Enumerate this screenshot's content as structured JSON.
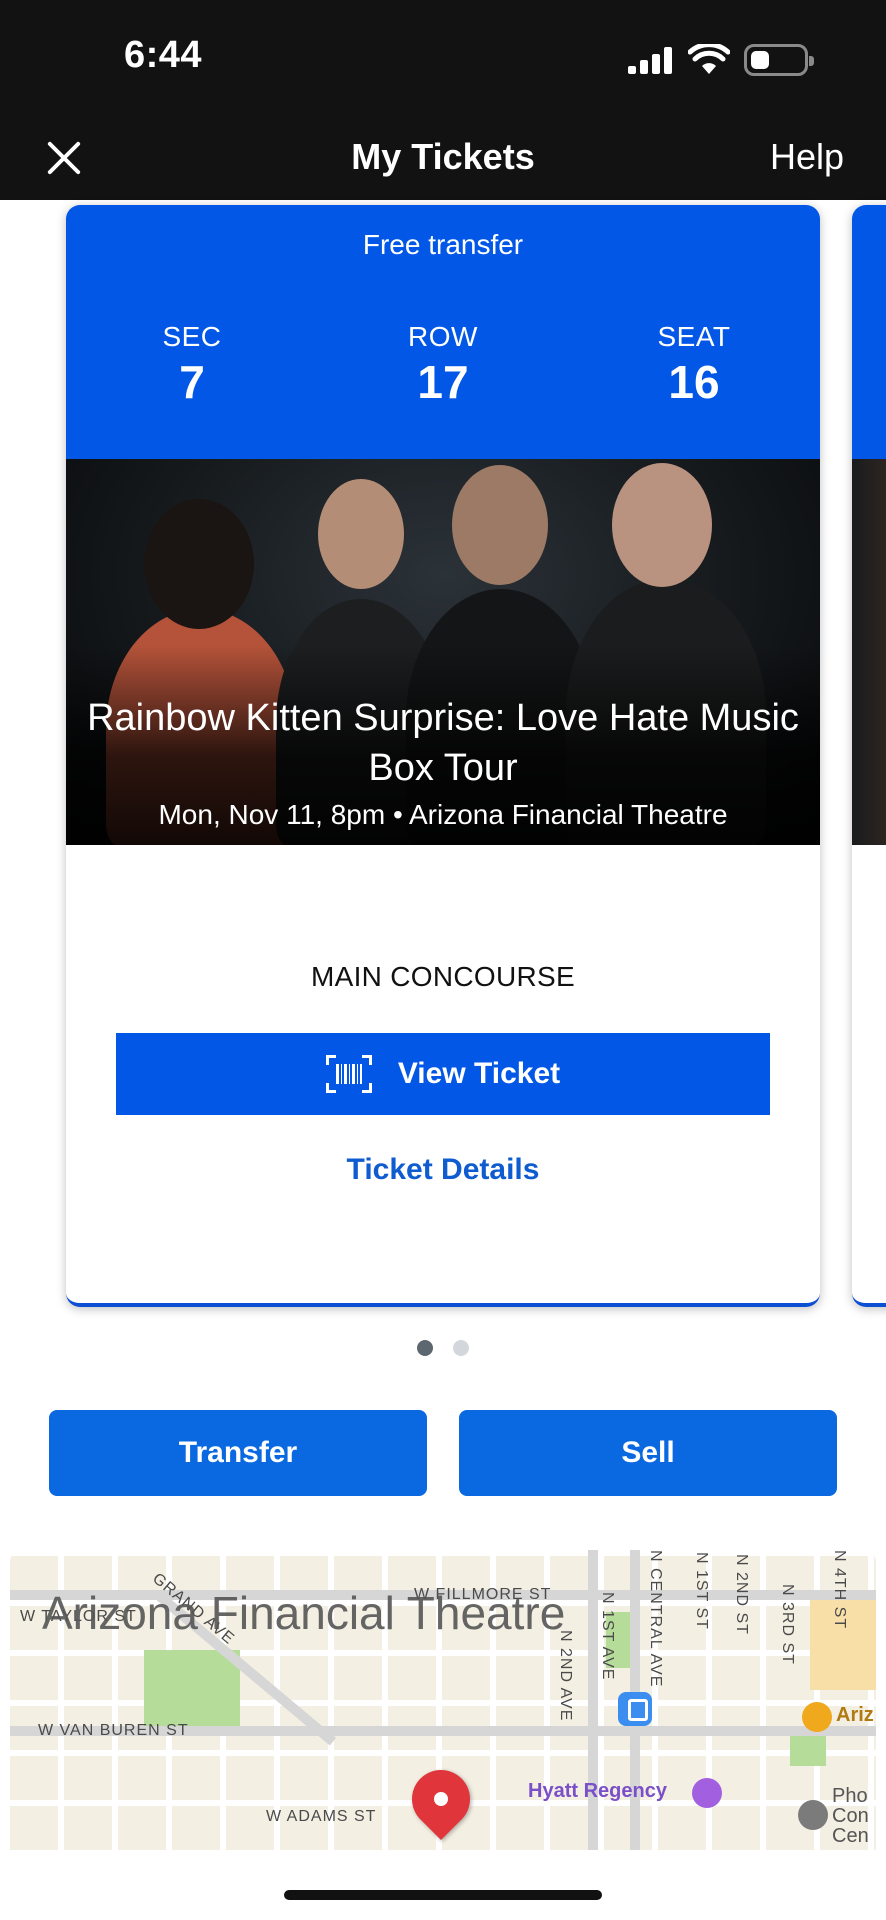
{
  "status_bar": {
    "time": "6:44",
    "icons": [
      "signal-icon",
      "wifi-icon",
      "battery-icon"
    ]
  },
  "nav": {
    "title": "My Tickets",
    "close_icon": "close-icon",
    "help_label": "Help"
  },
  "ticket": {
    "transfer_label": "Free transfer",
    "sec_label": "SEC",
    "sec_value": "7",
    "row_label": "ROW",
    "row_value": "17",
    "seat_label": "SEAT",
    "seat_value": "16",
    "event_title": "Rainbow Kitten Surprise: Love Hate Music Box Tour",
    "event_meta": "Mon, Nov 11, 8pm • Arizona Financial Theatre",
    "entrance": "MAIN CONCOURSE",
    "view_ticket_label": "View Ticket",
    "view_ticket_icon": "barcode-icon",
    "details_label": "Ticket Details"
  },
  "pager": {
    "total": 2,
    "active": 1
  },
  "actions": {
    "transfer_label": "Transfer",
    "sell_label": "Sell"
  },
  "map": {
    "title": "Arizona Financial Theatre",
    "streets": {
      "grand_ave": "GRAND AVE",
      "w_taylor": "W TAYLOR ST",
      "w_fillmore": "W FILLMORE ST",
      "w_van_buren": "W VAN BUREN ST",
      "w_adams": "W ADAMS ST",
      "n_1st_ave": "N 1ST AVE",
      "n_2nd_ave": "N 2ND AVE",
      "central_ave": "N CENTRAL AVE",
      "n_1st_st": "N 1ST ST",
      "n_2nd_st": "N 2ND ST",
      "n_3rd_st": "N 3RD ST",
      "n_4th_st": "N 4TH ST"
    },
    "pois": {
      "hotel": "Hyatt Regency",
      "arena": "Ariz",
      "convention": "Pho\nCon\nCen"
    },
    "colors": {
      "pin": "#e0353a",
      "park": "#b6dc9a",
      "hotel": "#a25fe0"
    }
  },
  "colors": {
    "header_bg": "#121212",
    "ticket_blue": "#0257e6",
    "action_blue": "#0a69e0",
    "link_blue": "#0f5bd0"
  }
}
